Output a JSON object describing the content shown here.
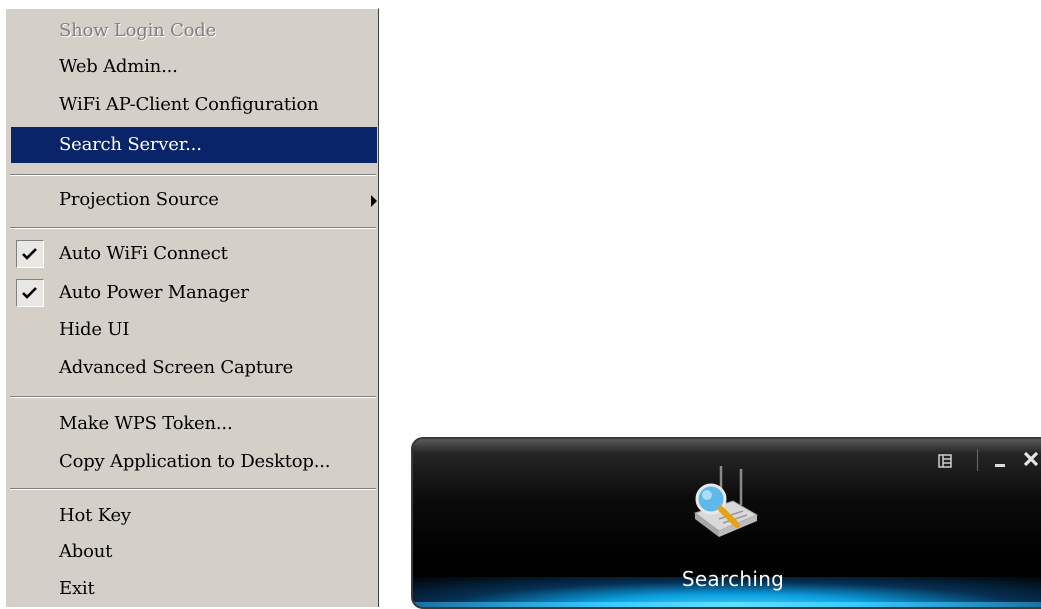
{
  "context_menu": {
    "items": [
      {
        "label": "Show Login Code",
        "disabled": true
      },
      {
        "label": "Web Admin..."
      },
      {
        "label": "WiFi AP-Client Configuration"
      },
      {
        "label": "Search Server...",
        "selected": true
      },
      {
        "label": "Projection Source",
        "submenu": true
      },
      {
        "label": "Auto WiFi Connect",
        "checked": true
      },
      {
        "label": "Auto Power Manager",
        "checked": true
      },
      {
        "label": "Hide UI"
      },
      {
        "label": "Advanced Screen Capture"
      },
      {
        "label": "Make WPS Token..."
      },
      {
        "label": "Copy Application to Desktop..."
      },
      {
        "label": "Hot Key"
      },
      {
        "label": "About"
      },
      {
        "label": "Exit"
      }
    ]
  },
  "widget": {
    "status": "Searching",
    "icons": [
      "menu-icon",
      "minimize-icon",
      "close-icon",
      "router-search-icon"
    ]
  },
  "colors": {
    "menu_background": "#d4d0c8",
    "selection": "#0a246a",
    "accent_glow": "#38c8ff"
  }
}
